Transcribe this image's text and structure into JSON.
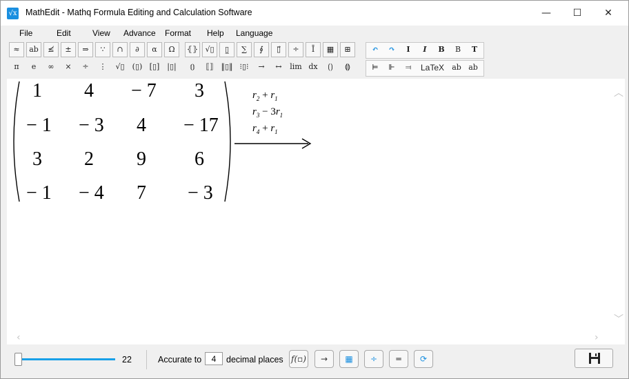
{
  "window": {
    "title": "MathEdit - Mathq Formula Editing and Calculation Software",
    "app_icon_glyph": "√x",
    "controls": {
      "minimize": "—",
      "maximize": "☐",
      "close": "✕"
    }
  },
  "menu": [
    "File",
    "Edit",
    "View",
    "Advance",
    "Format",
    "Help",
    "Language"
  ],
  "toolbar": {
    "row1": [
      "≈",
      "ab",
      "≰",
      "±",
      "⇒",
      "∵",
      "∩",
      "∂",
      "α",
      "Ω",
      "⦃⦄",
      "√▯",
      "▯̲",
      "∑",
      "∮",
      "▯⃗",
      "÷",
      "Ī",
      "▦",
      "⊞"
    ],
    "row2": [
      "π",
      "e",
      "∞",
      "×",
      "÷",
      "⋮",
      "√▯",
      "(▯)",
      "[▯]",
      "|▯|",
      "⦅⦆",
      "⟦⟧",
      "‖▯‖",
      "⁝▯⁝",
      "→",
      "↔",
      "lim",
      "dx",
      "⟮⟯",
      "⟬⟭"
    ],
    "format_row1": [
      "↶",
      "↷",
      "I",
      "I",
      "B",
      "B",
      "T"
    ],
    "format_row2": [
      "⊨",
      "⊩",
      "⫤",
      "LaTeX",
      "ab",
      "ab"
    ]
  },
  "matrix": {
    "rows": [
      [
        "1",
        "4",
        "− 7",
        "3"
      ],
      [
        "− 1",
        "− 3",
        "4",
        "− 17"
      ],
      [
        "3",
        "2",
        "9",
        "6"
      ],
      [
        "− 1",
        "− 4",
        "7",
        "− 3"
      ]
    ],
    "row_operations": [
      {
        "a": "r",
        "a_sub": "2",
        "op": "+",
        "b": "r",
        "b_sub": "1",
        "coef": ""
      },
      {
        "a": "r",
        "a_sub": "3",
        "op": "−",
        "b": "r",
        "b_sub": "1",
        "coef": "3"
      },
      {
        "a": "r",
        "a_sub": "4",
        "op": "+",
        "b": "r",
        "b_sub": "1",
        "coef": ""
      }
    ]
  },
  "status": {
    "zoom_value": "22",
    "accurate_label": "Accurate to",
    "decimal_places": "4",
    "decimal_label": "decimal places",
    "tool_buttons": [
      "f(▫)",
      "→",
      "▦",
      "÷",
      "═",
      "⟳"
    ],
    "accent": "#18a0e8"
  }
}
